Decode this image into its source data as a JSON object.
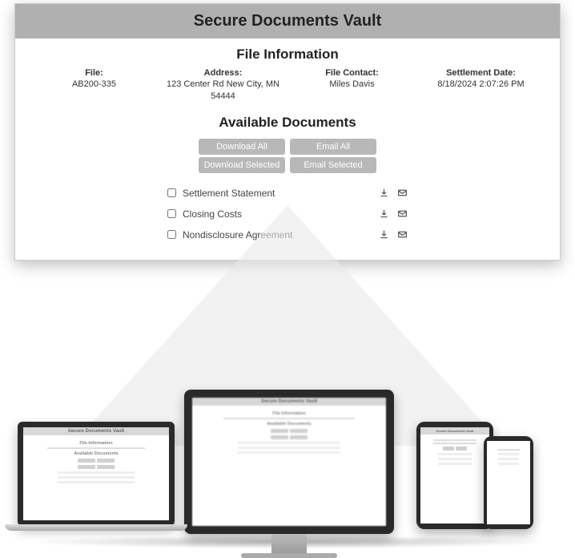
{
  "title": "Secure Documents Vault",
  "file_info_title": "File Information",
  "info": {
    "file_label": "File:",
    "file_value": "AB200-335",
    "address_label": "Address:",
    "address_value": "123 Center Rd New City, MN 54444",
    "contact_label": "File Contact:",
    "contact_value": "Miles Davis",
    "settlement_label": "Settlement Date:",
    "settlement_value": "8/18/2024 2:07:26 PM"
  },
  "available_title": "Available Documents",
  "buttons": {
    "download_all": "Download All",
    "email_all": "Email All",
    "download_selected": "Download Selected",
    "email_selected": "Email Selected"
  },
  "documents": [
    {
      "name": "Settlement Statement"
    },
    {
      "name": "Closing Costs"
    },
    {
      "name": "Nondisclosure Agreement"
    }
  ],
  "mini": {
    "title": "Secure Documents Vault",
    "file_info": "File Information",
    "avail": "Available Documents"
  }
}
